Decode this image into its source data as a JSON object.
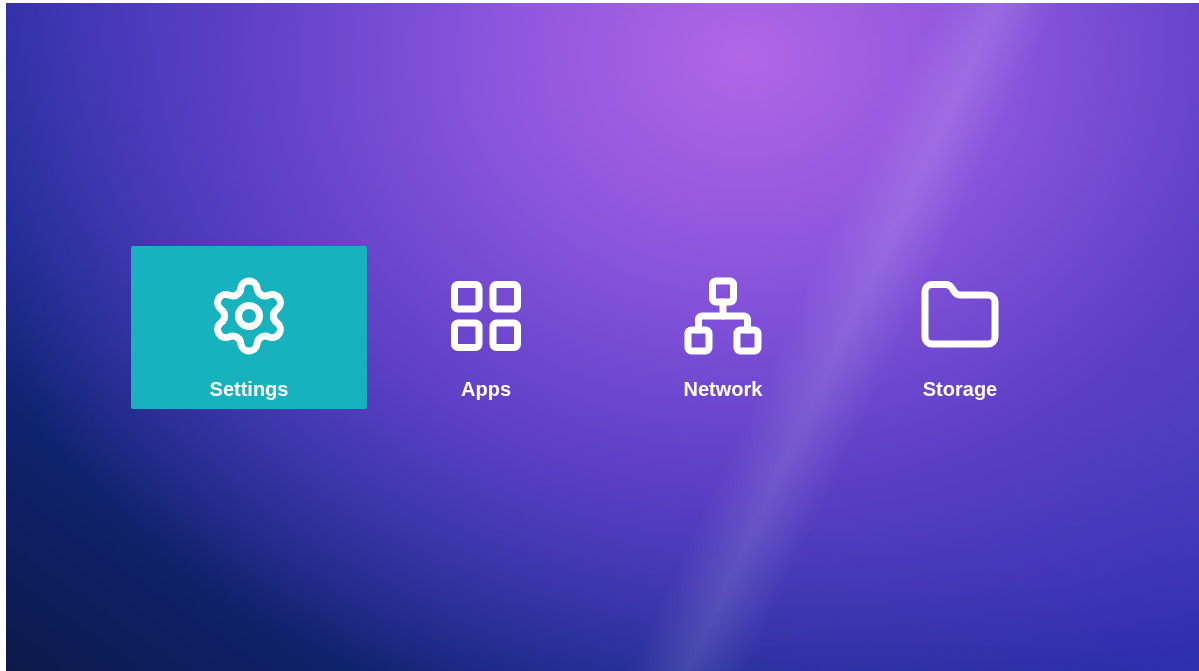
{
  "tiles": [
    {
      "kind": "settings",
      "label": "Settings",
      "selected": true
    },
    {
      "kind": "apps",
      "label": "Apps",
      "selected": false
    },
    {
      "kind": "network",
      "label": "Network",
      "selected": false
    },
    {
      "kind": "storage",
      "label": "Storage",
      "selected": false
    }
  ]
}
